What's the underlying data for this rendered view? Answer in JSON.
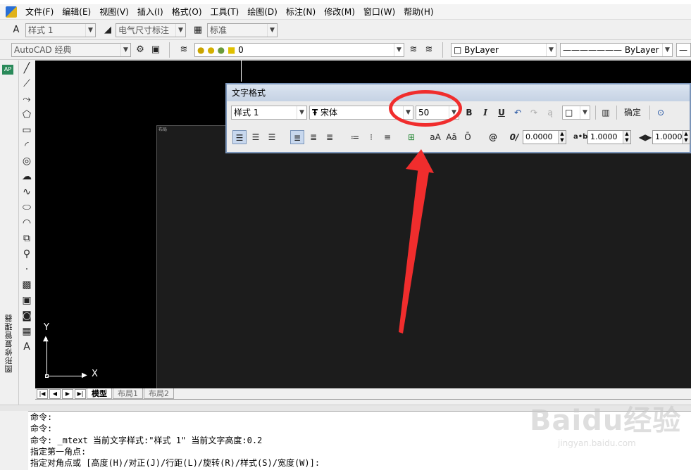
{
  "menubar": {
    "items": [
      "文件(F)",
      "编辑(E)",
      "视图(V)",
      "插入(I)",
      "格式(O)",
      "工具(T)",
      "绘图(D)",
      "标注(N)",
      "修改(M)",
      "窗口(W)",
      "帮助(H)"
    ]
  },
  "toolbar1": {
    "text_style": "样式 1",
    "dim_style": "电气尺寸标注",
    "table_style": "标准"
  },
  "toolbar2": {
    "workspace": "AutoCAD 经典",
    "layer": "0",
    "color": "ByLayer",
    "linetype": "ByLayer"
  },
  "side_panel": {
    "label": "图形修复管理器"
  },
  "text_format": {
    "title": "文字格式",
    "style": "样式 1",
    "font": "宋体",
    "height": "50",
    "ok_label": "确定",
    "oblique": "0.0000",
    "tracking": "1.0000",
    "width_factor": "1.0000"
  },
  "canvas": {
    "y_label": "Y",
    "x_label": "X",
    "paper_title": "布局"
  },
  "tabs": [
    "模型",
    "布局1",
    "布局2"
  ],
  "command_lines": [
    "命令:",
    "命令:",
    "命令: _mtext 当前文字样式:\"样式 1\"  当前文字高度:0.2",
    "指定第一角点:",
    "指定对角点或 [高度(H)/对正(J)/行距(L)/旋转(R)/样式(S)/宽度(W)]:"
  ],
  "watermark": {
    "brand": "Baidu经验",
    "url": "jingyan.baidu.com"
  },
  "colors": {
    "annotation_red": "#f02d2d",
    "canvas_bg": "#000000",
    "dialog_border": "#7a94b8"
  }
}
